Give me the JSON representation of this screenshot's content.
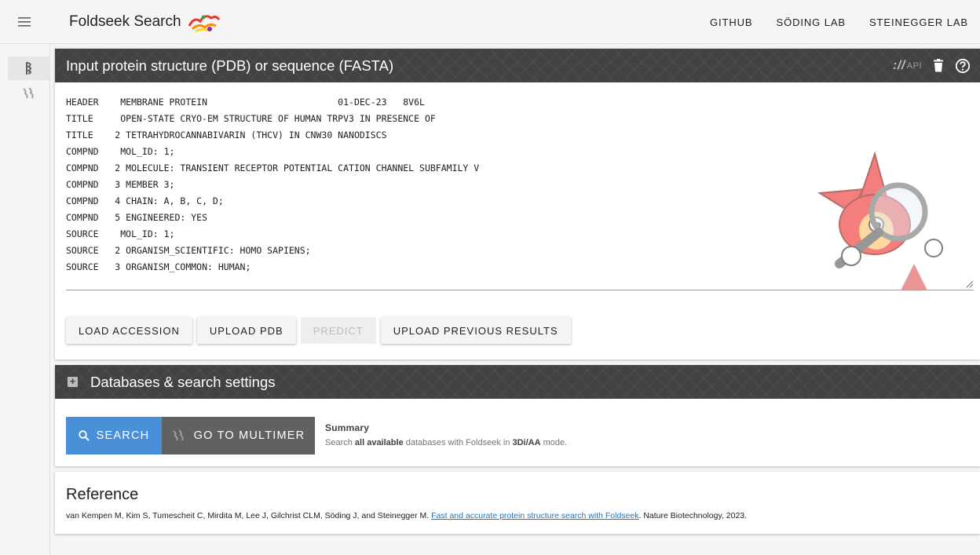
{
  "appbar": {
    "title": "Foldseek Search",
    "nav": [
      "GITHUB",
      "SÖDING LAB",
      "STEINEGGER LAB"
    ]
  },
  "input_panel": {
    "title": "Input protein structure (PDB) or sequence (FASTA)",
    "api_label": "API",
    "pdb_lines": [
      "HEADER    MEMBRANE PROTEIN                        01-DEC-23   8V6L",
      "TITLE     OPEN-STATE CRYO-EM STRUCTURE OF HUMAN TRPV3 IN PRESENCE OF",
      "TITLE    2 TETRAHYDROCANNABIVARIN (THCV) IN CNW30 NANODISCS",
      "COMPND    MOL_ID: 1;",
      "COMPND   2 MOLECULE: TRANSIENT RECEPTOR POTENTIAL CATION CHANNEL SUBFAMILY V",
      "COMPND   3 MEMBER 3;",
      "COMPND   4 CHAIN: A, B, C, D;",
      "COMPND   5 ENGINEERED: YES",
      "SOURCE    MOL_ID: 1;",
      "SOURCE   2 ORGANISM_SCIENTIFIC: HOMO SAPIENS;",
      "SOURCE   3 ORGANISM_COMMON: HUMAN;"
    ],
    "buttons": {
      "load_accession": "LOAD ACCESSION",
      "upload_pdb": "UPLOAD PDB",
      "predict": "PREDICT",
      "upload_previous": "UPLOAD PREVIOUS RESULTS"
    }
  },
  "databases_panel": {
    "title": "Databases & search settings"
  },
  "search_panel": {
    "search_label": "SEARCH",
    "multimer_label": "GO TO MULTIMER",
    "summary_title": "Summary",
    "summary_pre": "Search ",
    "summary_bold1": "all available",
    "summary_mid": " databases with Foldseek in ",
    "summary_bold2": "3Di/AA",
    "summary_post": " mode."
  },
  "reference": {
    "title": "Reference",
    "authors": "van Kempen M, Kim S, Tumescheit C, Mirdita M, Lee J, Gilchrist CLM, Söding J, and Steinegger M. ",
    "link_text": "Fast and accurate protein structure search with Foldseek",
    "suffix": ". Nature Biotechnology, 2023."
  },
  "colors": {
    "header_dark": "#424242",
    "search_blue": "#4a90d9",
    "multimer_gray": "#616161",
    "link": "#1e73be"
  },
  "icons": [
    "menu-icon",
    "structure-icon",
    "multimer-icon",
    "trash-icon",
    "help-icon",
    "plus-box-icon",
    "search-icon",
    "foldseek-logo-icon",
    "mascot-image"
  ]
}
